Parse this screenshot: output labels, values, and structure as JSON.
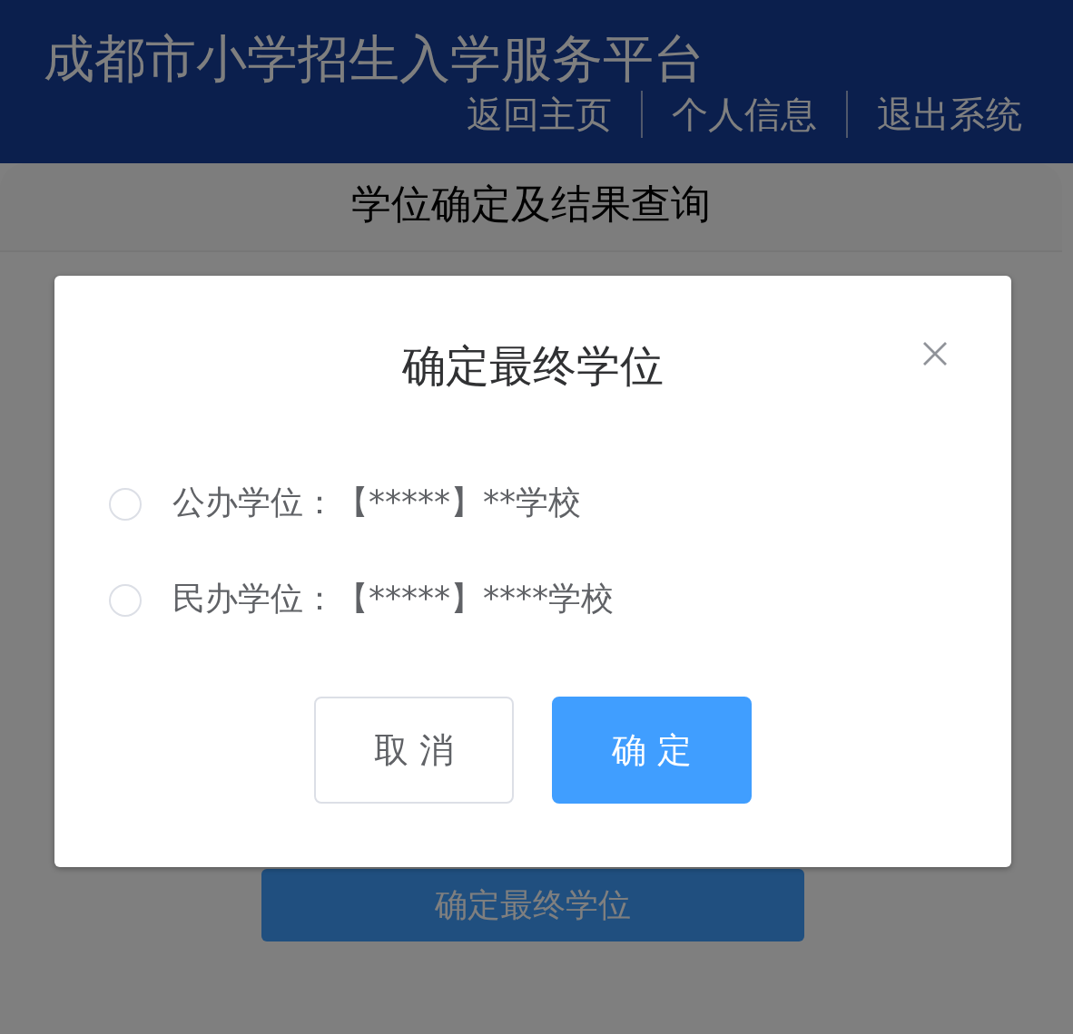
{
  "header": {
    "title": "成都市小学招生入学服务平台",
    "nav": [
      "返回主页",
      "个人信息",
      "退出系统"
    ]
  },
  "card": {
    "title": "学位确定及结果查询",
    "button": "确定最终学位"
  },
  "dialog": {
    "title": "确定最终学位",
    "options": [
      {
        "text": "公办学位：【*****】**学校",
        "selected": false
      },
      {
        "text": "民办学位：【*****】****学校",
        "selected": false
      }
    ],
    "buttons": [
      {
        "label": "取 消",
        "kind": "default"
      },
      {
        "label": "确 定",
        "kind": "primary"
      }
    ]
  }
}
